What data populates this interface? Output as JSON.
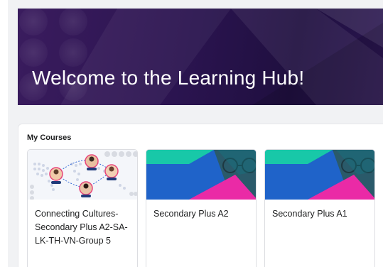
{
  "banner": {
    "title": "Welcome to the Learning Hub!",
    "colors": {
      "primary": "#2b1450",
      "accent": "#4a2a78"
    }
  },
  "courses": {
    "heading": "My Courses",
    "cards": [
      {
        "title": "Connecting Cultures-Secondary Plus A2-SA-LK-TH-VN-Group 5",
        "image_icon": "world-map-people-icon"
      },
      {
        "title": "Secondary Plus A2",
        "image_icon": "abstract-geometric-face-icon"
      },
      {
        "title": "Secondary Plus A1",
        "image_icon": "abstract-geometric-face-icon"
      }
    ]
  },
  "theme": {
    "teal": "#18c8a8",
    "blue": "#1f63c9",
    "magenta": "#ea2aa6"
  }
}
